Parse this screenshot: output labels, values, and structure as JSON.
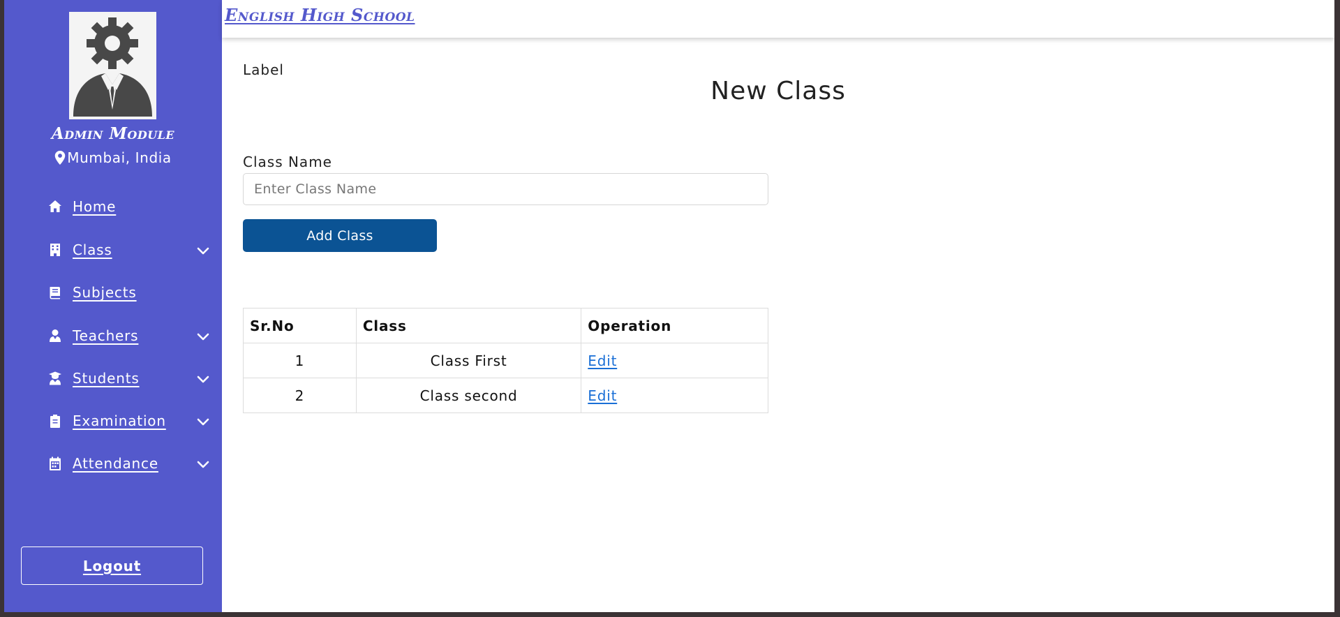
{
  "sidebar": {
    "module_title": "Admin Module",
    "location": "Mumbai, India",
    "items": [
      {
        "label": "Home",
        "icon": "home-icon",
        "has_dropdown": false
      },
      {
        "label": "Class",
        "icon": "building-icon",
        "has_dropdown": true
      },
      {
        "label": "Subjects",
        "icon": "book-icon",
        "has_dropdown": false
      },
      {
        "label": "Teachers",
        "icon": "user-tie-icon",
        "has_dropdown": true
      },
      {
        "label": "Students",
        "icon": "user-graduate-icon",
        "has_dropdown": true
      },
      {
        "label": "Examination",
        "icon": "clipboard-icon",
        "has_dropdown": true
      },
      {
        "label": "Attendance",
        "icon": "calendar-icon",
        "has_dropdown": true
      }
    ],
    "logout_label": "Logout"
  },
  "header": {
    "school_name": "English High School"
  },
  "main": {
    "label_text": "Label",
    "page_title": "New Class",
    "class_name_label": "Class Name",
    "class_name_placeholder": "Enter Class Name",
    "class_name_value": "",
    "add_button_label": "Add Class"
  },
  "table": {
    "columns": [
      "Sr.No",
      "Class",
      "Operation"
    ],
    "rows": [
      {
        "sr_no": "1",
        "class": "Class First",
        "operation": "Edit"
      },
      {
        "sr_no": "2",
        "class": "Class second",
        "operation": "Edit"
      }
    ]
  },
  "colors": {
    "sidebar_bg": "#5459cc",
    "accent": "#5459cc",
    "button_bg": "#0b5394",
    "link": "#1a6fd6"
  }
}
